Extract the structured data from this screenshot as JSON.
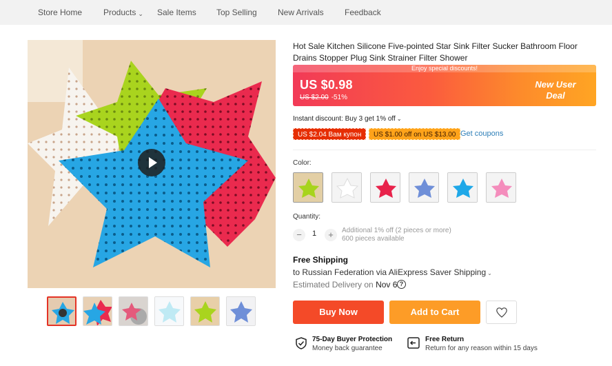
{
  "nav": {
    "items": [
      "Store Home",
      "Products",
      "Sale Items",
      "Top Selling",
      "New Arrivals",
      "Feedback"
    ]
  },
  "product": {
    "title": "Hot Sale Kitchen Silicone Five-pointed Star Sink Filter Sucker Bathroom Floor Drains Stopper Plug Sink Strainer Filter Shower",
    "image_subject": "star-shaped silicone sink strainers in blue, red, green, white"
  },
  "price": {
    "banner_text": "Enjoy special discounts!",
    "current": "US $0.98",
    "original": "US $2.00",
    "discount": "-51%",
    "promo": "New User Deal"
  },
  "discount": {
    "instant": "Instant discount: Buy 3 get 1% off",
    "coupon_1": "US $2.04 Вам купон",
    "coupon_2": "US $1.00 off on US $13.00",
    "get_coupons": "Get coupons"
  },
  "color": {
    "label": "Color:",
    "options": [
      "green",
      "white",
      "red",
      "purple-blue",
      "sky-blue",
      "pink"
    ],
    "swatch_colors": [
      "#a7d41d",
      "#f5f5f5",
      "#e8234b",
      "#6f8fd8",
      "#1fa8e8",
      "#f48dbc"
    ]
  },
  "quantity": {
    "label": "Quantity:",
    "value": "1",
    "note_1": "Additional 1% off (2 pieces or more)",
    "note_2": "600 pieces available"
  },
  "shipping": {
    "title": "Free Shipping",
    "route": "to Russian Federation via AliExpress Saver Shipping",
    "estimated_label": "Estimated Delivery on",
    "estimated_date": "Nov 6"
  },
  "actions": {
    "buy_now": "Buy Now",
    "add_to_cart": "Add to Cart"
  },
  "guarantees": {
    "protection_title": "75-Day Buyer Protection",
    "protection_sub": "Money back guarantee",
    "return_title": "Free Return",
    "return_sub": "Return for any reason within 15 days"
  },
  "colors": {
    "accent_red": "#f44a28",
    "accent_orange": "#fd9c27",
    "link_blue": "#2e7fb8"
  }
}
